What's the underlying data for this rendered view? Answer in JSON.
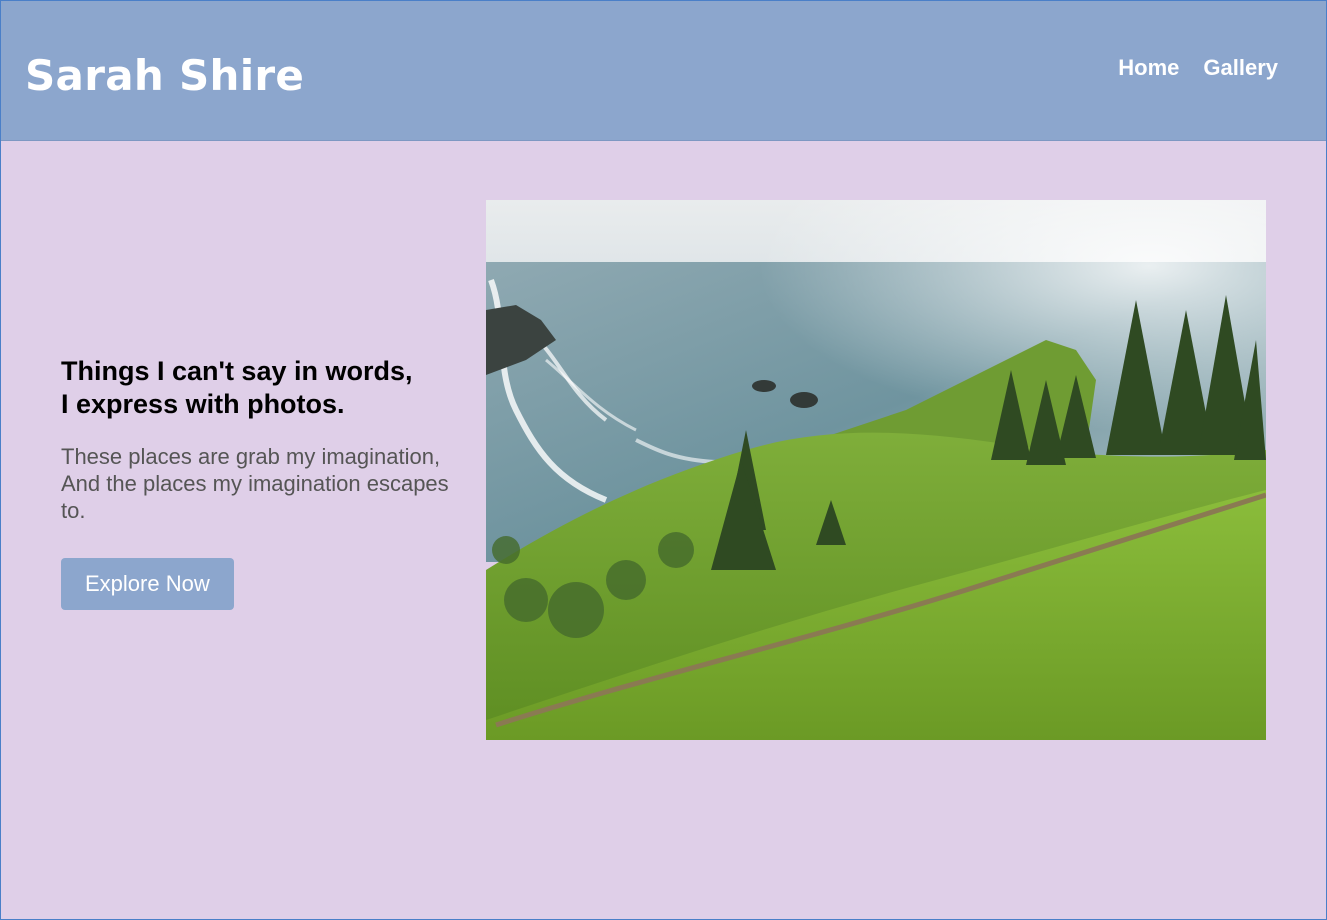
{
  "header": {
    "brand": "Sarah Shire",
    "nav": [
      {
        "label": "Home"
      },
      {
        "label": "Gallery"
      }
    ],
    "background": "#8ca6cd"
  },
  "hero": {
    "headline": "Things I can't say in words,\nI express with photos.",
    "tagline": "These places are grab my imagination,\nAnd the places my imagination escapes\nto.",
    "cta_label": "Explore Now",
    "image": {
      "subject": "coastal-grassy-hillside-photo"
    }
  },
  "colors": {
    "page_background": "#dfcfe8",
    "accent": "#8ca6cd",
    "text_dark": "#000000",
    "text_muted": "#555555"
  }
}
